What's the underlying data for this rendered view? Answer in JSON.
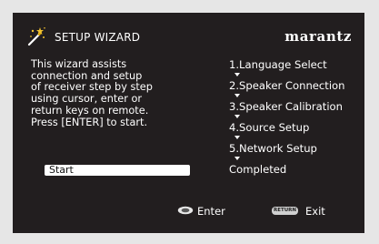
{
  "header": {
    "title": "SETUP WIZARD",
    "brand": "marantz",
    "wizard_icon": "magic-wand-icon"
  },
  "description": "This wizard assists\nconnection and setup\nof receiver step by step\nusing cursor, enter or\nreturn keys on remote.\nPress [ENTER] to start.",
  "start_button": "Start",
  "steps": [
    "1.Language Select",
    "2.Speaker Connection",
    "3.Speaker Calibration",
    "4.Source Setup",
    "5.Network Setup",
    "Completed"
  ],
  "footer": {
    "enter_label": "Enter",
    "enter_icon": "enter-button-icon",
    "return_badge": "RETURN",
    "exit_label": "Exit"
  },
  "colors": {
    "background": "#221e1f",
    "text": "#ffffff",
    "page": "#e6e6e6"
  }
}
